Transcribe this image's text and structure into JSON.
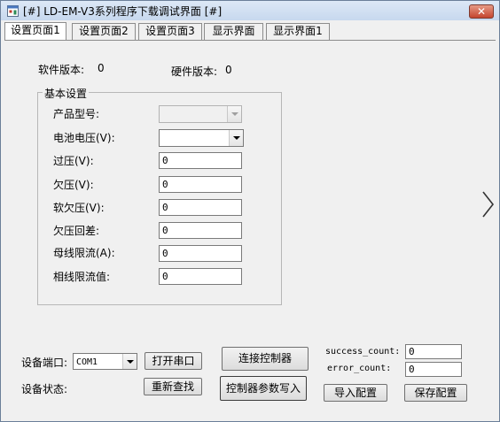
{
  "window": {
    "title": "[#] LD-EM-V3系列程序下载调试界面 [#]",
    "close_glyph": "✕"
  },
  "tabs": [
    {
      "label": "设置页面1",
      "active": true
    },
    {
      "label": "设置页面2",
      "active": false
    },
    {
      "label": "设置页面3",
      "active": false
    },
    {
      "label": "显示界面",
      "active": false
    },
    {
      "label": "显示界面1",
      "active": false
    }
  ],
  "versions": {
    "software_label": "软件版本:",
    "software_value": "0",
    "hardware_label": "硬件版本:",
    "hardware_value": "0"
  },
  "basic": {
    "legend": "基本设置",
    "product_model_label": "产品型号:",
    "product_model_value": "",
    "battery_voltage_label": "电池电压(V):",
    "battery_voltage_value": "",
    "overvoltage_label": "过压(V):",
    "overvoltage_value": "0",
    "undervoltage_label": "欠压(V):",
    "undervoltage_value": "0",
    "soft_undervoltage_label": "软欠压(V):",
    "soft_undervoltage_value": "0",
    "undervoltage_hysteresis_label": "欠压回差:",
    "undervoltage_hysteresis_value": "0",
    "bus_current_limit_label": "母线限流(A):",
    "bus_current_limit_value": "0",
    "phase_current_limit_label": "相线限流值:",
    "phase_current_limit_value": "0"
  },
  "bottom": {
    "port_label": "设备端口:",
    "port_value": "COM1",
    "open_port_button": "打开串口",
    "status_label": "设备状态:",
    "rescan_button": "重新查找",
    "connect_button": "连接控制器",
    "write_params_button": "控制器参数写入",
    "success_label": "success_count:",
    "success_value": "0",
    "error_label": "error_count:",
    "error_value": "0",
    "import_button": "导入配置",
    "save_button": "保存配置"
  },
  "icons": {
    "app": "app-window-icon",
    "next": "chevron-right-icon"
  }
}
